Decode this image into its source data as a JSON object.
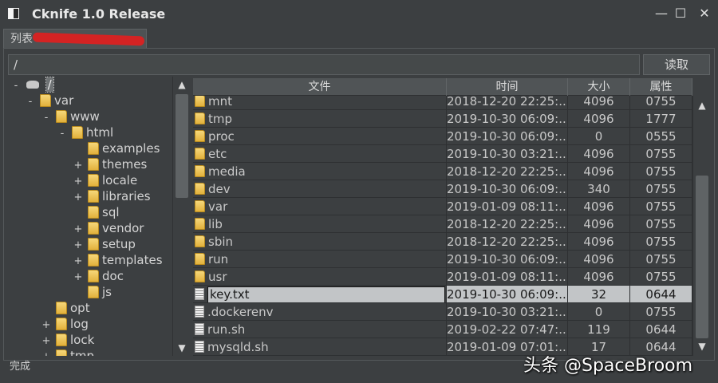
{
  "window": {
    "title": "Cknife 1.0 Release",
    "controls": {
      "minimize": "—",
      "maximize": "☐",
      "close": "✕"
    }
  },
  "tab": {
    "label": "列表"
  },
  "path_bar": {
    "value": "/",
    "read_button": "读取"
  },
  "tree": {
    "root": "/",
    "nodes": [
      {
        "label": "var",
        "expander": "-",
        "level": 1
      },
      {
        "label": "www",
        "expander": "-",
        "level": 2
      },
      {
        "label": "html",
        "expander": "-",
        "level": 3
      },
      {
        "label": "examples",
        "expander": "",
        "level": 4
      },
      {
        "label": "themes",
        "expander": "+",
        "level": 4
      },
      {
        "label": "locale",
        "expander": "+",
        "level": 4
      },
      {
        "label": "libraries",
        "expander": "+",
        "level": 4
      },
      {
        "label": "sql",
        "expander": "",
        "level": 4
      },
      {
        "label": "vendor",
        "expander": "+",
        "level": 4
      },
      {
        "label": "setup",
        "expander": "+",
        "level": 4
      },
      {
        "label": "templates",
        "expander": "+",
        "level": 4
      },
      {
        "label": "doc",
        "expander": "+",
        "level": 4
      },
      {
        "label": "js",
        "expander": "",
        "level": 4
      },
      {
        "label": "opt",
        "expander": "",
        "level": 2
      },
      {
        "label": "log",
        "expander": "+",
        "level": 2
      },
      {
        "label": "lock",
        "expander": "+",
        "level": 2
      },
      {
        "label": "tmp",
        "expander": "+",
        "level": 2
      }
    ]
  },
  "table": {
    "headers": {
      "name": "文件",
      "time": "时间",
      "size": "大小",
      "attr": "属性"
    },
    "rows": [
      {
        "type": "folder",
        "name": "mnt",
        "time": "2018-12-20 22:25:...",
        "size": "4096",
        "attr": "0755"
      },
      {
        "type": "folder",
        "name": "tmp",
        "time": "2019-10-30 06:09:...",
        "size": "4096",
        "attr": "1777"
      },
      {
        "type": "folder",
        "name": "proc",
        "time": "2019-10-30 06:09:...",
        "size": "0",
        "attr": "0555"
      },
      {
        "type": "folder",
        "name": "etc",
        "time": "2019-10-30 03:21:...",
        "size": "4096",
        "attr": "0755"
      },
      {
        "type": "folder",
        "name": "media",
        "time": "2018-12-20 22:25:...",
        "size": "4096",
        "attr": "0755"
      },
      {
        "type": "folder",
        "name": "dev",
        "time": "2019-10-30 06:09:...",
        "size": "340",
        "attr": "0755"
      },
      {
        "type": "folder",
        "name": "var",
        "time": "2019-01-09 08:11:...",
        "size": "4096",
        "attr": "0755"
      },
      {
        "type": "folder",
        "name": "lib",
        "time": "2018-12-20 22:25:...",
        "size": "4096",
        "attr": "0755"
      },
      {
        "type": "folder",
        "name": "sbin",
        "time": "2018-12-20 22:25:...",
        "size": "4096",
        "attr": "0755"
      },
      {
        "type": "folder",
        "name": "run",
        "time": "2019-10-30 06:09:...",
        "size": "4096",
        "attr": "0755"
      },
      {
        "type": "folder",
        "name": "usr",
        "time": "2019-01-09 08:11:...",
        "size": "4096",
        "attr": "0755"
      },
      {
        "type": "file",
        "name": "key.txt",
        "time": "2019-10-30 06:09:...",
        "size": "32",
        "attr": "0644",
        "selected": true
      },
      {
        "type": "file",
        "name": ".dockerenv",
        "time": "2019-10-30 03:21:...",
        "size": "0",
        "attr": "0755"
      },
      {
        "type": "file",
        "name": "run.sh",
        "time": "2019-02-22 07:47:...",
        "size": "119",
        "attr": "0644"
      },
      {
        "type": "file",
        "name": "mysqld.sh",
        "time": "2019-01-09 07:01:...",
        "size": "17",
        "attr": "0644"
      }
    ]
  },
  "status": {
    "text": "完成"
  },
  "watermark": {
    "text": "头条 @SpaceBroom"
  },
  "colors": {
    "background": "#3c3f41",
    "selection": "#c2c5c7",
    "folder": "#e2b13c",
    "redaction": "#e02020"
  }
}
